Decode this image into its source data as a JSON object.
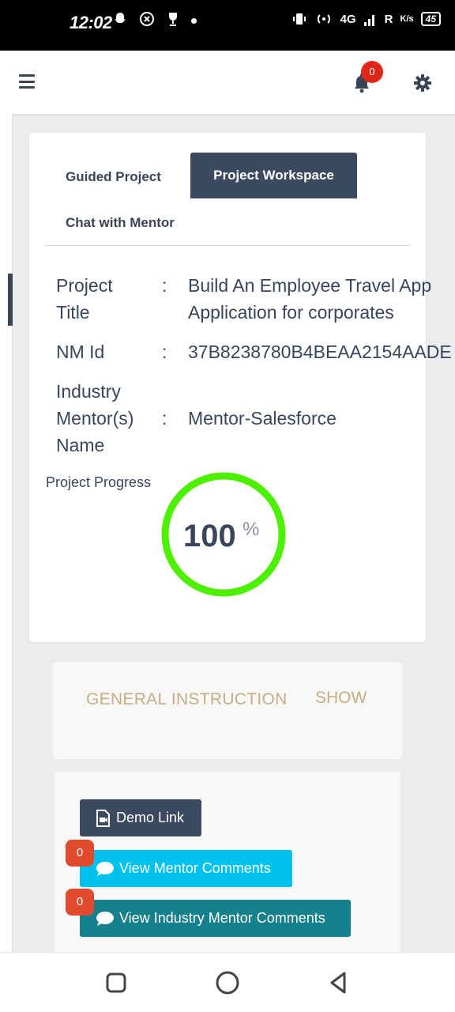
{
  "status_bar": {
    "time": "12:02",
    "network": "4G",
    "roaming": "R",
    "speed": "K/s",
    "battery": "45"
  },
  "header": {
    "notification_count": "0"
  },
  "tabs": [
    {
      "label": "Guided Project",
      "active": false
    },
    {
      "label": "Project Workspace",
      "active": true
    },
    {
      "label": "Chat with Mentor",
      "active": false
    }
  ],
  "project": {
    "title_label_line1": "Project",
    "title_label_line2": "Title",
    "title_value_line1": "Build An Employee Travel App",
    "title_value_line2": "Application for corporates",
    "nm_label": "NM Id",
    "nm_value": "37B8238780B4BEAA2154AADE",
    "mentor_label_line1": "Industry",
    "mentor_label_line2": "Mentor(s)",
    "mentor_label_line3": "Name",
    "mentor_value": "Mentor-Salesforce",
    "colon": ":"
  },
  "progress": {
    "label": "Project Progress",
    "value": "100",
    "unit": "%",
    "fraction": 1.0,
    "ring_color": "#4cf000"
  },
  "instructions": {
    "title": "GENERAL INSTRUCTION",
    "toggle": "SHOW"
  },
  "actions": {
    "demo_label": "Demo Link",
    "mentor_comments_label": "View Mentor Comments",
    "mentor_comments_count": "0",
    "industry_comments_label": "View Industry Mentor Comments",
    "industry_comments_count": "0"
  },
  "colors": {
    "primary": "#3c4a60",
    "info": "#00c2ee",
    "teal": "#17808d",
    "badge": "#e04b2f",
    "accent_text": "#c7ad86"
  }
}
